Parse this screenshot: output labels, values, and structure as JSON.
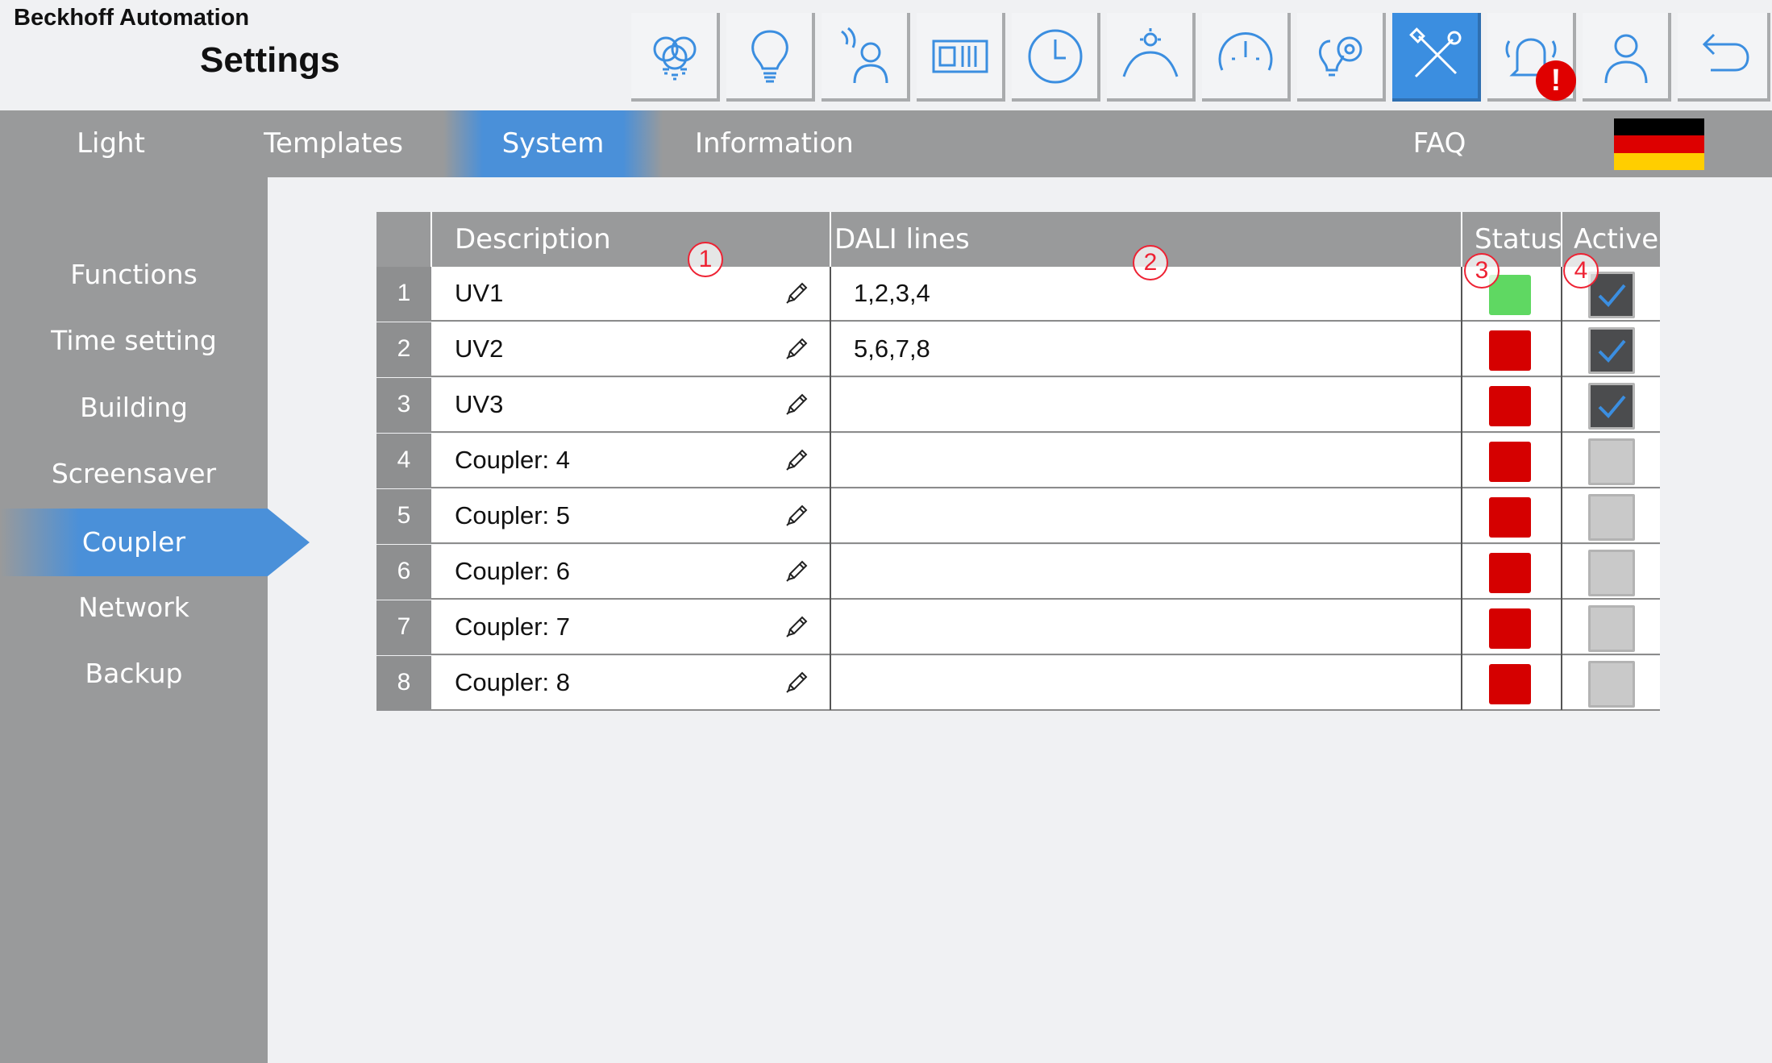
{
  "header": {
    "company": "Beckhoff Automation",
    "title": "Settings"
  },
  "toolbar": {
    "icons": [
      "lights-icon",
      "bulb-icon",
      "presence-icon",
      "projector-icon",
      "clock-icon",
      "daylight-icon",
      "gauge-icon",
      "scene-icon",
      "tools-icon",
      "alarm-icon",
      "user-icon",
      "back-icon"
    ],
    "active": "tools-icon",
    "alarm_badge": "!",
    "accent_color": "#3b8ee0"
  },
  "nav": {
    "tabs": [
      "Light",
      "Templates",
      "System",
      "Information",
      "FAQ"
    ],
    "selected": "System",
    "language_flag": "german-flag"
  },
  "sidebar": {
    "items": [
      "Functions",
      "Time setting",
      "Building",
      "Screensaver",
      "Coupler",
      "Network",
      "Backup"
    ],
    "selected": "Coupler"
  },
  "table": {
    "columns": [
      "Description",
      "DALI lines",
      "Status",
      "Active"
    ],
    "rows": [
      {
        "num": "1",
        "description": "UV1",
        "dali": "1,2,3,4",
        "status": "ok",
        "active": true
      },
      {
        "num": "2",
        "description": "UV2",
        "dali": "5,6,7,8",
        "status": "error",
        "active": true
      },
      {
        "num": "3",
        "description": "UV3",
        "dali": "",
        "status": "error",
        "active": true
      },
      {
        "num": "4",
        "description": "Coupler: 4",
        "dali": "",
        "status": "error",
        "active": false
      },
      {
        "num": "5",
        "description": "Coupler: 5",
        "dali": "",
        "status": "error",
        "active": false
      },
      {
        "num": "6",
        "description": "Coupler: 6",
        "dali": "",
        "status": "error",
        "active": false
      },
      {
        "num": "7",
        "description": "Coupler: 7",
        "dali": "",
        "status": "error",
        "active": false
      },
      {
        "num": "8",
        "description": "Coupler: 8",
        "dali": "",
        "status": "error",
        "active": false
      }
    ],
    "status_colors": {
      "ok": "#5fd862",
      "error": "#d50000"
    }
  },
  "callouts": [
    "1",
    "2",
    "3",
    "4"
  ]
}
